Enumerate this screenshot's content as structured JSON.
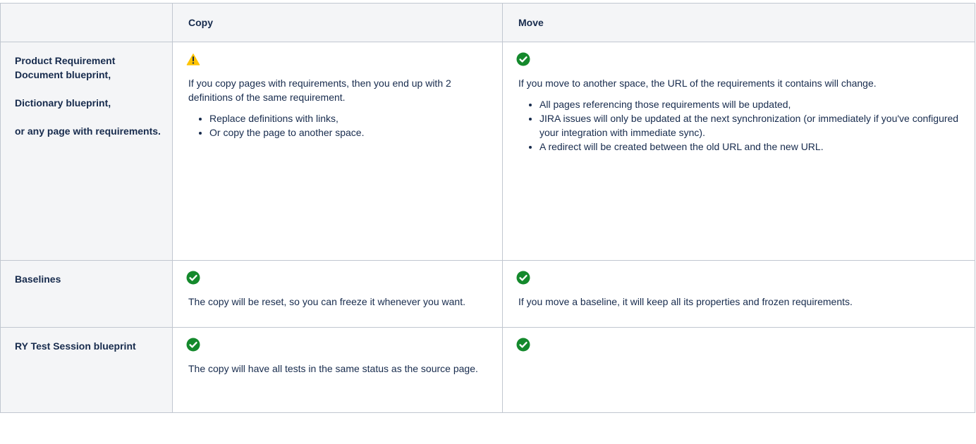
{
  "table": {
    "headers": [
      "",
      "Copy",
      "Move"
    ],
    "rows": [
      {
        "label_lines": [
          "Product Requirement Document blueprint,",
          "Dictionary blueprint,",
          "or any page with requirements."
        ],
        "copy": {
          "icon": "warning-icon",
          "text": "If you copy pages with requirements, then you end up with 2 definitions of the same requirement.",
          "bullets": [
            "Replace definitions with links,",
            "Or copy the page to another space."
          ]
        },
        "move": {
          "icon": "check-circle-icon",
          "text": "If you move to another space, the URL of the requirements it contains will change.",
          "bullets": [
            "All pages referencing those requirements will be updated,",
            "JIRA issues will only be updated at the next synchronization (or immediately if you've configured your integration with immediate sync).",
            "A redirect will be created between the old URL and the new URL."
          ]
        }
      },
      {
        "label_lines": [
          "Baselines"
        ],
        "copy": {
          "icon": "check-circle-icon",
          "text": "The copy will be reset, so you can freeze it whenever you want."
        },
        "move": {
          "icon": "check-circle-icon",
          "text": "If you move a baseline, it will keep all its properties and frozen requirements."
        }
      },
      {
        "label_lines": [
          "RY Test Session blueprint"
        ],
        "copy": {
          "icon": "check-circle-icon",
          "text": "The copy will have all tests in the same status as the source page."
        },
        "move": {
          "icon": "check-circle-icon"
        }
      }
    ]
  },
  "colors": {
    "success": "#14892c",
    "warning": "#ffc400",
    "header_bg": "#f4f5f7",
    "border": "#c1c7d0"
  }
}
